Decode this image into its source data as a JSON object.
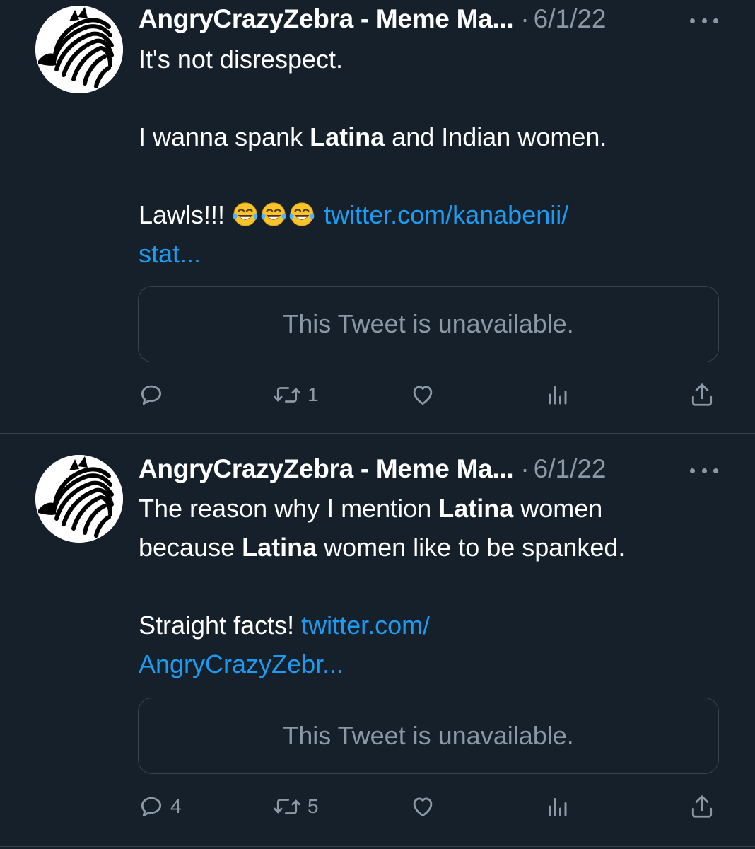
{
  "tweets": [
    {
      "display_name": "AngryCrazyZebra - Meme Ma...",
      "separator": "·",
      "date": "6/1/22",
      "body": {
        "line1": "It's not disrespect.",
        "line2_before": "I wanna spank ",
        "line2_bold": "Latina",
        "line2_after": " and Indian women.",
        "line3_text": "Lawls!!! ",
        "line3_emoji": [
          "😂",
          "😂",
          "😂"
        ],
        "link_part1": "twitter.com/kanabenii/",
        "link_part2": "stat..."
      },
      "quote_text": "This Tweet is unavailable.",
      "actions": {
        "reply_count": "",
        "retweet_count": "1",
        "like_count": "",
        "views_count": ""
      }
    },
    {
      "display_name": "AngryCrazyZebra - Meme Ma...",
      "separator": "·",
      "date": "6/1/22",
      "body": {
        "line1_before": "The reason why I mention ",
        "line1_bold": "Latina",
        "line1_after": " women",
        "line2_before": "because ",
        "line2_bold": "Latina",
        "line2_after": " women like to be spanked.",
        "line3_text": "Straight facts! ",
        "link_part1": "twitter.com/",
        "link_part2": "AngryCrazyZebr..."
      },
      "quote_text": "This Tweet is unavailable.",
      "actions": {
        "reply_count": "4",
        "retweet_count": "5",
        "like_count": "",
        "views_count": ""
      }
    }
  ],
  "icons": {
    "avatar": "zebra-avatar",
    "more": "more-horizontal-icon",
    "reply": "reply-bubble-icon",
    "retweet": "retweet-icon",
    "like": "heart-icon",
    "views": "views-bar-chart-icon",
    "share": "share-upload-icon"
  },
  "colors": {
    "background": "#15202b",
    "text": "#ffffff",
    "secondary": "#8b98a5",
    "link": "#1d9bf0",
    "border": "#38444d"
  }
}
